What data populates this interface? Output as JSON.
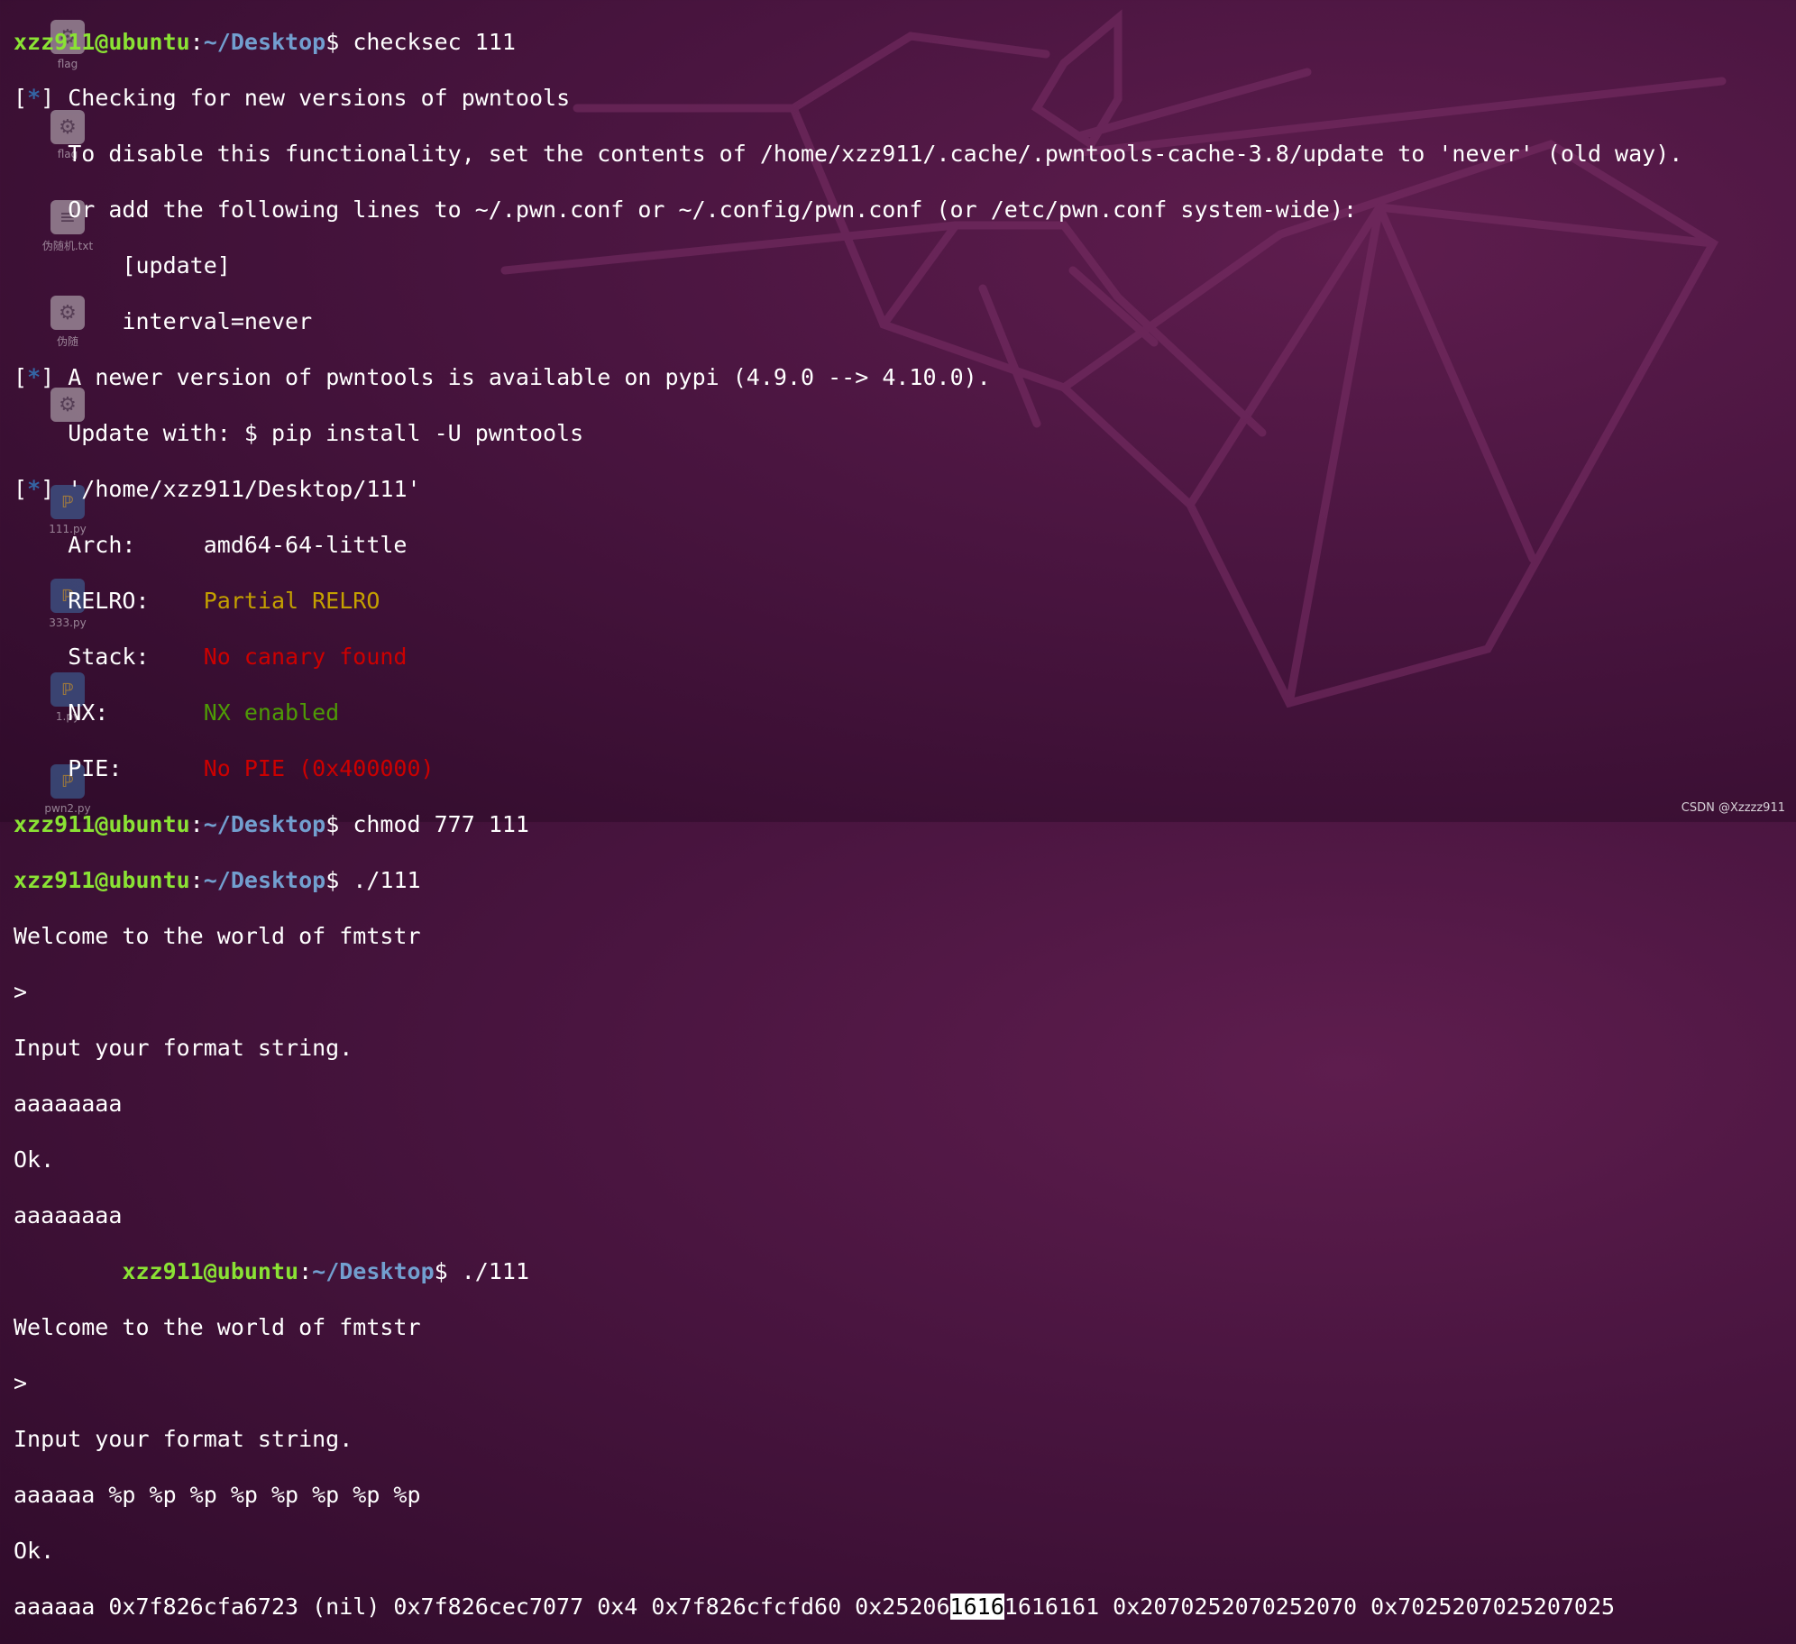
{
  "prompt": {
    "user_host": "xzz911@ubuntu",
    "path": "~/Desktop",
    "symbol": "$"
  },
  "desktop_icons": [
    {
      "label": "flag",
      "icon": "gear-icon"
    },
    {
      "label": "flag",
      "icon": "gear-icon"
    },
    {
      "label": "伪随机.txt",
      "icon": "text-file-icon"
    },
    {
      "label": "伪随",
      "icon": "gear-icon"
    },
    {
      "label": "",
      "icon": "gear-icon"
    },
    {
      "label": "111.py",
      "icon": "python-icon"
    },
    {
      "label": "333.py",
      "icon": "python-icon"
    },
    {
      "label": "1.py",
      "icon": "python-icon"
    },
    {
      "label": "pwn2.py",
      "icon": "python-icon"
    }
  ],
  "terminal": {
    "cmd1": " checksec 111",
    "star": "*",
    "checking": " Checking for new versions of pwntools",
    "disable": "    To disable this functionality, set the contents of /home/xzz911/.cache/.pwntools-cache-3.8/update to 'never' (old way).",
    "or_add": "    Or add the following lines to ~/.pwn.conf or ~/.config/pwn.conf (or /etc/pwn.conf system-wide):",
    "update_section": "        [update]",
    "interval": "        interval=never",
    "newer": " A newer version of pwntools is available on pypi (4.9.0 --> 4.10.0).",
    "update_with": "    Update with: $ pip install -U pwntools",
    "file_path": " '/home/xzz911/Desktop/111'",
    "arch_key": "    Arch:     ",
    "arch_val": "amd64-64-little",
    "relro_key": "    RELRO:    ",
    "relro_val": "Partial RELRO",
    "stack_key": "    Stack:    ",
    "stack_val": "No canary found",
    "nx_key": "    NX:       ",
    "nx_val": "NX enabled",
    "pie_key": "    PIE:      ",
    "pie_val": "No PIE (0x400000)",
    "cmd2": " chmod 777 111",
    "cmd3": " ./111",
    "welcome": "Welcome to the world of fmtstr",
    "gt": ">",
    "input_prompt": "Input your format string.",
    "input1": "aaaaaaaa",
    "ok": "Ok.",
    "output1": "aaaaaaaa",
    "indent": "        ",
    "cmd4": " ./111",
    "input2": "aaaaaa %p %p %p %p %p %p %p %p",
    "out2_a": "aaaaaa 0x7f826cfa6723 (nil) 0x7f826cec7077 0x4 0x7f826cfcfd60 0x25206",
    "out2_hl": "1616",
    "out2_b": "1616161 0x2070252070252070 0x7025207025207025"
  },
  "watermark": "CSDN @Xzzzz911"
}
